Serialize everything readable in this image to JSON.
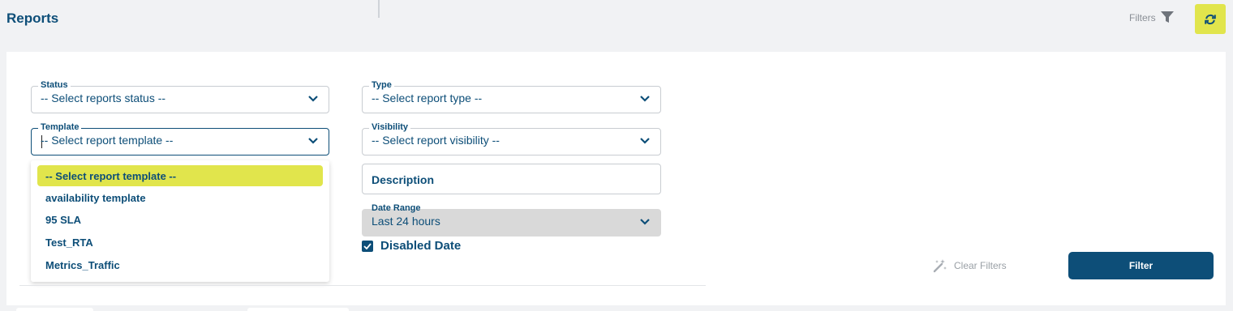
{
  "header": {
    "title": "Reports",
    "filters_label": "Filters",
    "filter_icon": "funnel-icon",
    "refresh_icon": "refresh-icon"
  },
  "form": {
    "status": {
      "label": "Status",
      "placeholder": "-- Select reports status --"
    },
    "type": {
      "label": "Type",
      "placeholder": "-- Select report type --"
    },
    "template": {
      "label": "Template",
      "placeholder": "-- Select report template --",
      "options": [
        "-- Select report template --",
        "availability template",
        "95 SLA",
        "Test_RTA",
        "Metrics_Traffic"
      ]
    },
    "visibility": {
      "label": "Visibility",
      "placeholder": "-- Select report visibility --"
    },
    "description": {
      "placeholder": "Description"
    },
    "date_range": {
      "label": "Date Range",
      "value": "Last 24 hours"
    },
    "disabled_date": {
      "label": "Disabled Date",
      "checked": true
    }
  },
  "actions": {
    "clear_filters": "Clear Filters",
    "filter": "Filter"
  },
  "colors": {
    "primary": "#0d4e78",
    "accent": "#e1e54c",
    "background": "#f1f2f4"
  }
}
